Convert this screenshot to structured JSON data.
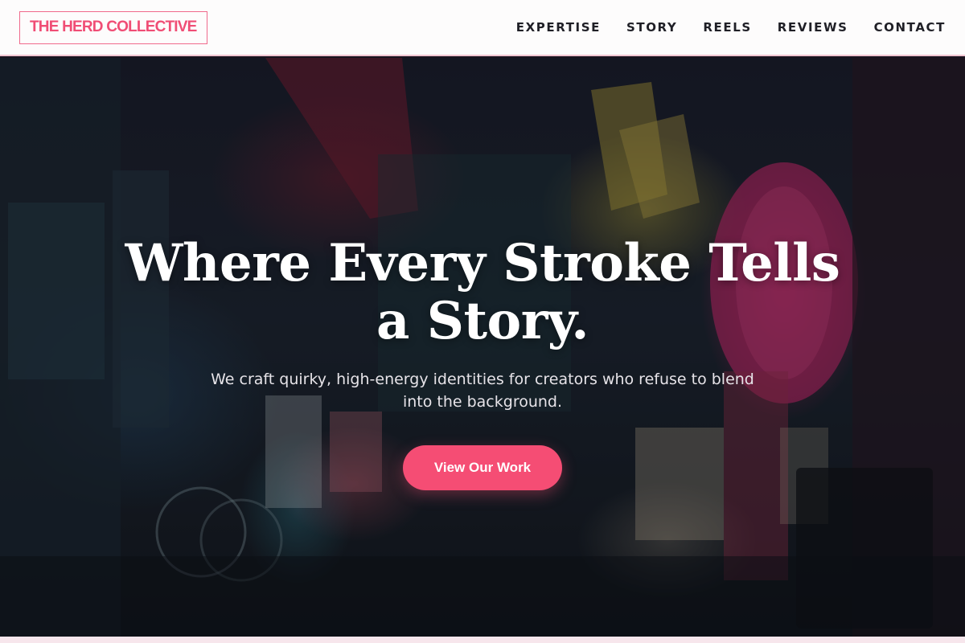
{
  "header": {
    "logo": "THE HERD COLLECTIVE",
    "nav": [
      {
        "label": "EXPERTISE"
      },
      {
        "label": "STORY"
      },
      {
        "label": "REELS"
      },
      {
        "label": "REVIEWS"
      },
      {
        "label": "CONTACT"
      }
    ]
  },
  "hero": {
    "title": "Where Every Stroke Tells a Story.",
    "subtitle": "We craft quirky, high-energy identities for creators who refuse to blend into the background.",
    "cta_label": "View Our Work",
    "background_image": "neon-alley-street-photo"
  },
  "colors": {
    "accent": "#f54d74",
    "nav_text": "#1f1f26",
    "hero_title": "#ffffff"
  }
}
